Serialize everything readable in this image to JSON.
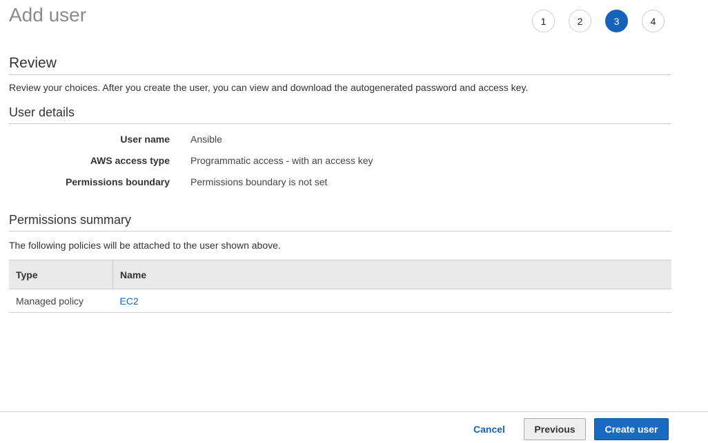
{
  "header": {
    "title": "Add user",
    "steps": [
      "1",
      "2",
      "3",
      "4"
    ],
    "active_step": 3
  },
  "review": {
    "heading": "Review",
    "description": "Review your choices. After you create the user, you can view and download the autogenerated password and access key."
  },
  "user_details": {
    "heading": "User details",
    "rows": [
      {
        "label": "User name",
        "value": "Ansible"
      },
      {
        "label": "AWS access type",
        "value": "Programmatic access - with an access key"
      },
      {
        "label": "Permissions boundary",
        "value": "Permissions boundary is not set"
      }
    ]
  },
  "permissions_summary": {
    "heading": "Permissions summary",
    "description": "The following policies will be attached to the user shown above.",
    "columns": [
      "Type",
      "Name"
    ],
    "rows": [
      {
        "type": "Managed policy",
        "name": "EC2"
      }
    ]
  },
  "footer": {
    "cancel_label": "Cancel",
    "previous_label": "Previous",
    "create_label": "Create user"
  },
  "colors": {
    "accent": "#1662b8",
    "primary_button": "#1a6ac4"
  }
}
